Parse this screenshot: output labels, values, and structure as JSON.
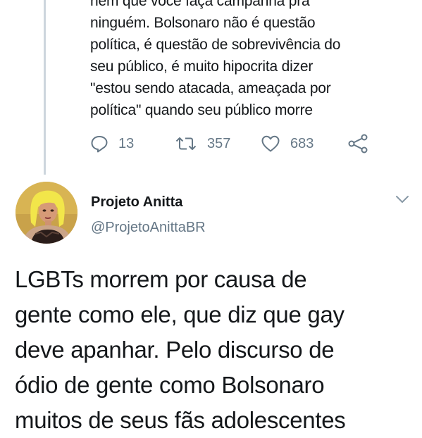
{
  "previous_tweet": {
    "text_lines": [
      "nem que você faça campanha pra",
      "ninguém. Bolsonaro não é questão",
      "política, é questão de sobrevivência do",
      "seu público, é muito hipocrita dizer",
      "\"estou sendo atacada, ameaçada por",
      "política\" quando seu público morre"
    ],
    "actions": {
      "reply_count": "13",
      "retweet_count": "357",
      "like_count": "683"
    }
  },
  "tweet": {
    "author_name": "Projeto Anitta",
    "author_handle": "@ProjetoAnittaBR",
    "text_lines": [
      "LGBTs morrem por causa de",
      "gente como ele, que diz que gay",
      "deve apanhar. Pelo discurso de",
      "ódio de gente como Bolsonaro",
      "muitos de seus fãs adolescentes"
    ]
  },
  "icons": {
    "reply": "reply-icon",
    "retweet": "retweet-icon",
    "like": "heart-icon",
    "share": "share-icon",
    "menu": "chevron-down-icon"
  },
  "colors": {
    "text": "#14171a",
    "secondary": "#657786",
    "thread_line": "#cdd6dd"
  }
}
